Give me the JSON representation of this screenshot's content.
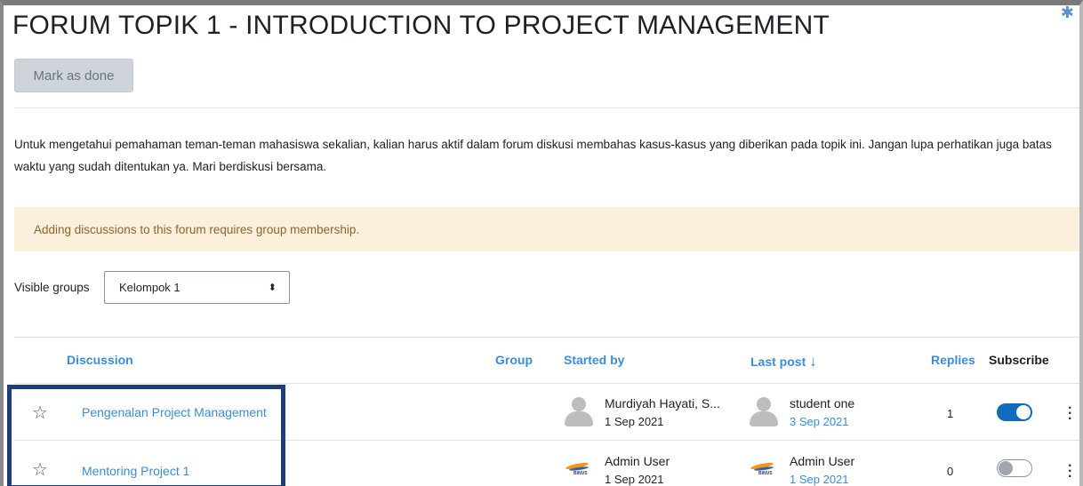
{
  "page": {
    "title": "FORUM TOPIK 1 - INTRODUCTION TO PROJECT MANAGEMENT",
    "mark_done_label": "Mark as done",
    "intro_text": "Untuk mengetahui pemahaman teman-teman mahasiswa sekalian, kalian harus aktif dalam forum diskusi membahas kasus-kasus yang diberikan pada topik ini. Jangan lupa perhatikan juga batas waktu yang sudah ditentukan ya. Mari berdiskusi bersama.",
    "alert_text": "Adding discussions to this forum requires group membership."
  },
  "groups": {
    "label": "Visible groups",
    "selected": "Kelompok 1"
  },
  "table": {
    "headers": {
      "discussion": "Discussion",
      "group": "Group",
      "started_by": "Started by",
      "last_post": "Last post",
      "replies": "Replies",
      "subscribe": "Subscribe"
    },
    "rows": [
      {
        "title": "Pengenalan Project Management",
        "started_by": "Murdiyah Hayati, S...",
        "started_date": "1 Sep 2021",
        "last_post_by": "student one",
        "last_post_date": "3 Sep 2021",
        "replies": "1",
        "subscribed": true
      },
      {
        "title": "Mentoring Project 1",
        "started_by": "Admin User",
        "started_date": "1 Sep 2021",
        "last_post_by": "Admin User",
        "last_post_date": "1 Sep 2021",
        "replies": "0",
        "subscribed": false
      }
    ]
  },
  "icons": {
    "settings": "gear-icon",
    "star": "star-outline-icon",
    "sort": "arrow-down-icon",
    "menu": "kebab-menu-icon"
  },
  "colors": {
    "link": "#3a8dd6",
    "alert_bg": "#fcefdc",
    "alert_text": "#8e662e",
    "toggle_on": "#0f6cbf",
    "highlight_border": "#1f3d7a"
  }
}
